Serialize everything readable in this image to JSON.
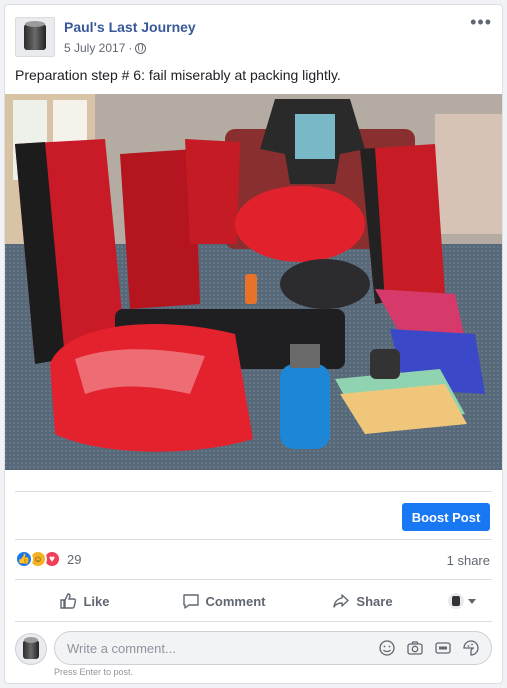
{
  "post": {
    "author": "Paul's Last Journey",
    "date": "5 July 2017",
    "date_separator": "·",
    "more_label": "•••",
    "text": "Preparation step # 6: fail miserably at packing lightly.",
    "privacy_icon": "globe-icon",
    "photo_subject": "red bicycle panniers and camping gear"
  },
  "boost": {
    "label": "Boost Post",
    "color": "#1877f2"
  },
  "engagement": {
    "reactions": [
      "like-icon",
      "haha-icon",
      "love-icon"
    ],
    "reaction_count": "29",
    "share_count": "1 share"
  },
  "actions": {
    "like_label": "Like",
    "comment_label": "Comment",
    "share_label": "Share"
  },
  "comment": {
    "placeholder": "Write a comment...",
    "hint": "Press Enter to post.",
    "icons": [
      "emoji-icon",
      "camera-icon",
      "gif-icon",
      "sticker-icon"
    ]
  },
  "colors": {
    "link": "#385898",
    "accent": "#1877f2",
    "muted": "#606770"
  }
}
